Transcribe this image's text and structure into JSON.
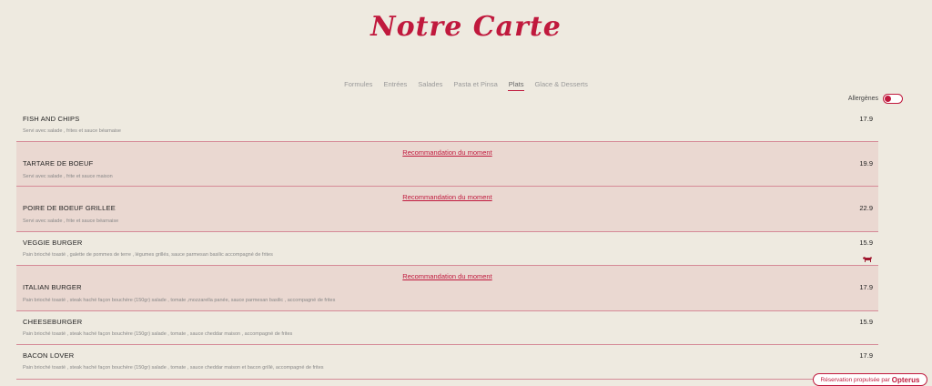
{
  "header": {
    "title": "Notre Carte"
  },
  "tabs": [
    {
      "label": "Formules"
    },
    {
      "label": "Entrées"
    },
    {
      "label": "Salades"
    },
    {
      "label": "Pasta et Pinsa"
    },
    {
      "label": "Plats",
      "active": true
    },
    {
      "label": "Glace & Desserts"
    }
  ],
  "allergen": {
    "label": "Allergènes",
    "enabled": false
  },
  "recommendation_label": "Recommandation du moment",
  "items": [
    {
      "name": "FISH AND CHIPS",
      "description": "Servi avec salade , frites et sauce béarnaise",
      "price": "17.9",
      "recommended": false
    },
    {
      "name": "TARTARE DE BOEUF",
      "description": "Servi avec salade , frite et sauce maison",
      "price": "19.9",
      "recommended": true
    },
    {
      "name": "POIRE DE BOEUF GRILLEE",
      "description": "Servi avec salade , frite et sauce béarnaise",
      "price": "22.9",
      "recommended": true
    },
    {
      "name": "VEGGIE BURGER",
      "description": "Pain brioché toasté , galette de pommes de terre , légumes grillés, sauce parmesan basilic accompagné de frites",
      "price": "15.9",
      "recommended": false,
      "icon": "cow-icon"
    },
    {
      "name": "ITALIAN BURGER",
      "description": "Pain brioché toasté , steak haché façon bouchère (150gr) salade , tomate ,mozzarella panée, sauce parmesan basilic , accompagné de frites",
      "price": "17.9",
      "recommended": true
    },
    {
      "name": "CHEESEBURGER",
      "description": "Pain brioché toasté , steak haché façon bouchère (150gr) salade , tomate , sauce cheddar maison , accompagné de frites",
      "price": "15.9",
      "recommended": false
    },
    {
      "name": "BACON LOVER",
      "description": "Pain brioché toasté , steak haché façon bouchère (150gr) salade , tomate , sauce cheddar maison et bacon grillé, accompagné de frites",
      "price": "17.9",
      "recommended": false
    }
  ],
  "footer": {
    "reservation_text": "Réservation propulsée par",
    "brand": "Opterus"
  },
  "colors": {
    "accent": "#c0193d",
    "background": "#eeeae0",
    "recommended_bg": "#ead8d1"
  }
}
